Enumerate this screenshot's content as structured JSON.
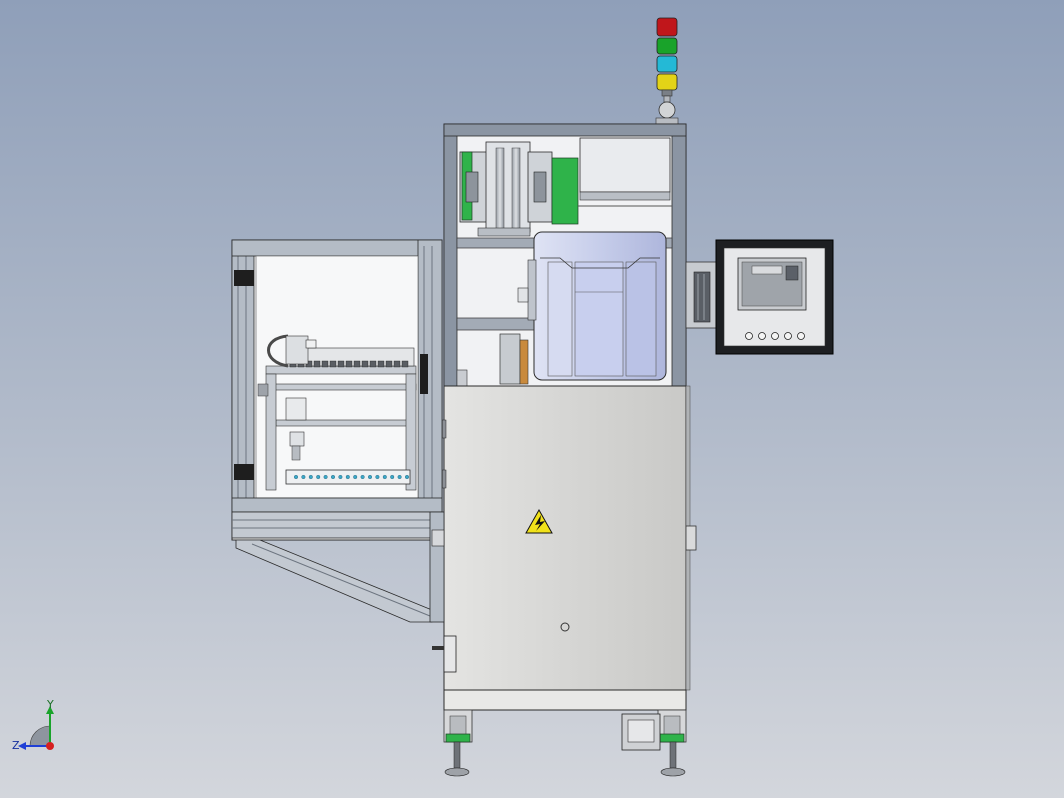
{
  "view": {
    "background_top": "#8f9fb9",
    "background_bottom": "#d3d6dc"
  },
  "machine": {
    "signal_tower_colors": [
      "#c0161b",
      "#19a32a",
      "#24b9d6",
      "#e3d317"
    ],
    "cabinet_color": "#d8d8d6",
    "frame_color": "#8b95a3",
    "guide_rail_color": "#2fb34a",
    "warning_sign_color": "#f1e21a",
    "hmi_buttons_count": 5
  },
  "triad": {
    "y_label": "Y",
    "z_label": "Z",
    "y_axis_color": "#19a32a",
    "z_axis_color": "#1f3fd6",
    "x_axis_color": "#d61f1f"
  }
}
